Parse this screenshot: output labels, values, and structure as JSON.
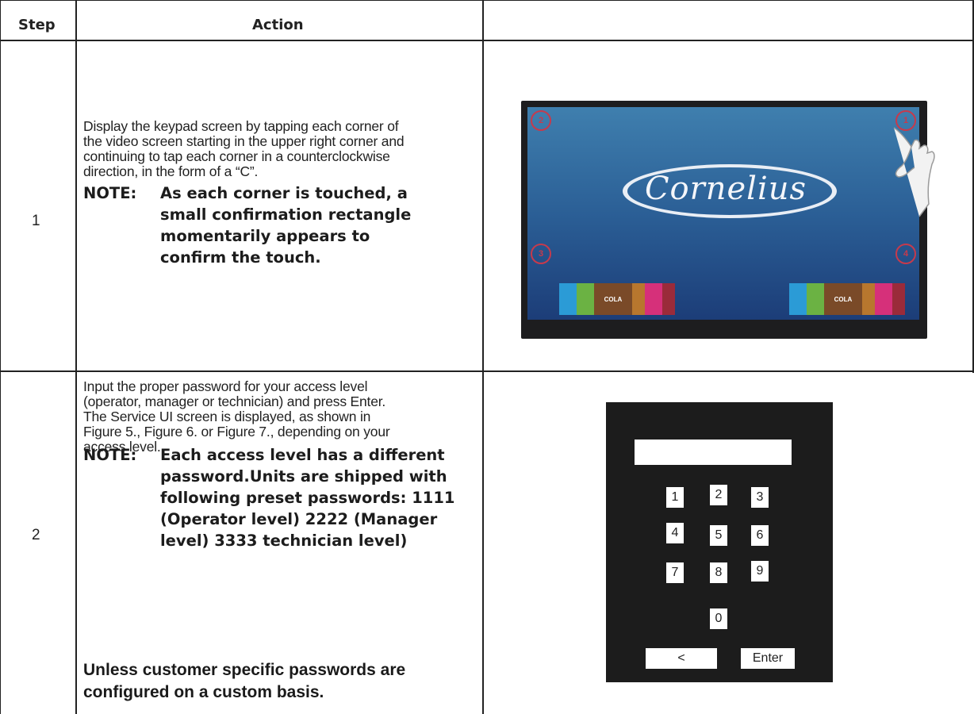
{
  "table": {
    "header": {
      "step": "Step",
      "action": "Action"
    },
    "rows": [
      {
        "step": "1",
        "text": "Display the keypad screen by tapping each corner of the video screen starting in the upper right corner and continuing to tap each corner in a counterclockwise direction, in the form of a “C”.",
        "note_prefix": "NOTE:",
        "note": "As each corner is touched, a small confirmation rectangle momentarily appears to confirm the touch."
      },
      {
        "step": "2",
        "text": "Input the proper password for your access level (operator, manager or technician) and press Enter. The Service UI screen is displayed, as shown in Figure 5., Figure 6. or Figure 7., depending on your access level.",
        "note_prefix": "NOTE:",
        "note": "Each access level has a different password.Units are shipped with following preset passwords: 1111 (Operator level) 2222 (Manager level) 3333 technician level)",
        "tail": "Unless customer specific passwords are configured on a custom basis."
      }
    ]
  },
  "tablet_image": {
    "logo_text": "Cornelius",
    "corner_numbers": [
      "2",
      "1",
      "3",
      "4"
    ],
    "tile_label": "COLA",
    "accent": "#c63a4c"
  },
  "keypad": {
    "keys": [
      "1",
      "2",
      "3",
      "4",
      "5",
      "6",
      "7",
      "8",
      "9",
      "0"
    ],
    "back": "<",
    "enter": "Enter"
  }
}
